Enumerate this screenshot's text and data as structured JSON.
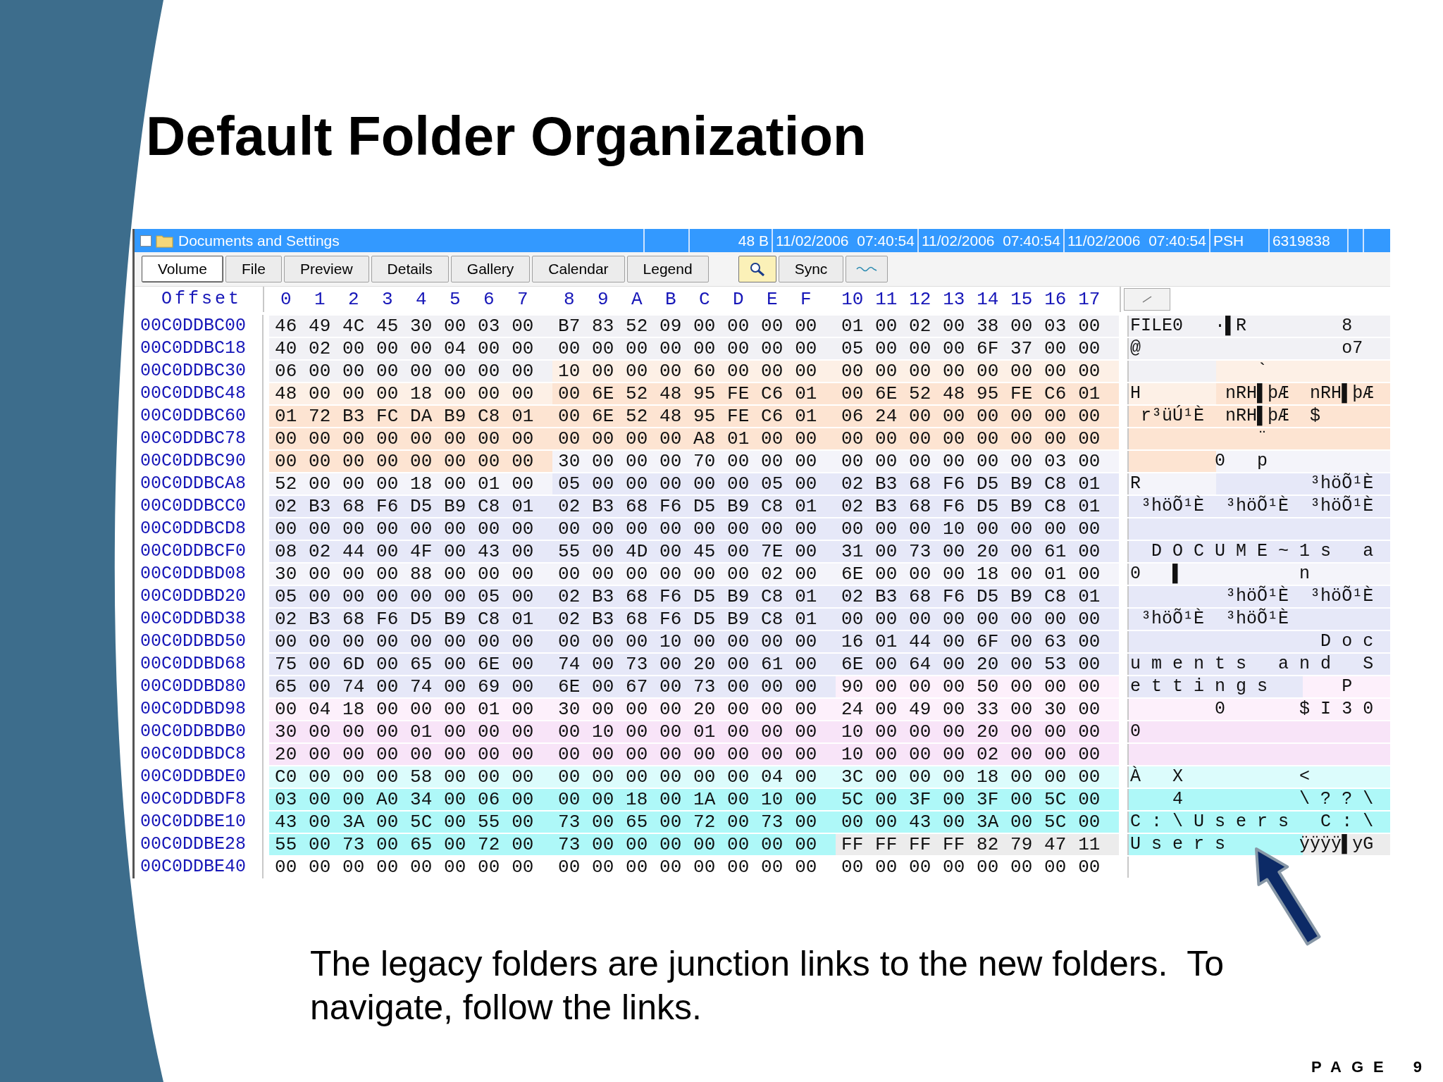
{
  "title": "Default Folder Organization",
  "file_entry": {
    "checked": false,
    "name": "Documents and Settings",
    "cells": [
      "48 B",
      "11/02/2006  07:40:54",
      "11/02/2006  07:40:54",
      "11/02/2006  07:40:54",
      "PSH",
      "6319838"
    ]
  },
  "tabs": [
    {
      "label": "Volume",
      "selected": true
    },
    {
      "label": "File",
      "selected": false
    },
    {
      "label": "Preview",
      "selected": false
    },
    {
      "label": "Details",
      "selected": false
    },
    {
      "label": "Gallery",
      "selected": false
    },
    {
      "label": "Calendar",
      "selected": false
    },
    {
      "label": "Legend",
      "selected": false
    }
  ],
  "sync_button": "Sync",
  "offset_header": "Offset",
  "column_labels": [
    "0",
    "1",
    "2",
    "3",
    "4",
    "5",
    "6",
    "7",
    "8",
    "9",
    "A",
    "B",
    "C",
    "D",
    "E",
    "F",
    "10",
    "11",
    "12",
    "13",
    "14",
    "15",
    "16",
    "17"
  ],
  "rows": [
    {
      "offset": "00C0DDBC00",
      "groups": [
        {
          "bytes": "46 49 4C 45 30 00 03 00",
          "color": "#f1f1f5"
        },
        {
          "bytes": "B7 83 52 09 00 00 00 00",
          "color": "#f1f1f5"
        },
        {
          "bytes": "01 00 02 00 38 00 03 00",
          "color": "#f1f1f5"
        }
      ],
      "ascii": "FILE0   ·▌R         8"
    },
    {
      "offset": "00C0DDBC18",
      "groups": [
        {
          "bytes": "40 02 00 00 00 04 00 00",
          "color": "#f1f1f5"
        },
        {
          "bytes": "00 00 00 00 00 00 00 00",
          "color": "#f1f1f5"
        },
        {
          "bytes": "05 00 00 00 6F 37 00 00",
          "color": "#f1f1f5"
        }
      ],
      "ascii": "@                   o7"
    },
    {
      "offset": "00C0DDBC30",
      "groups": [
        {
          "bytes": "06 00 00 00 00 00 00 00",
          "color": "#f1f1f5"
        },
        {
          "bytes": "10 00 00 00 60 00 00 00",
          "color": "#fdf0e6"
        },
        {
          "bytes": "00 00 00 00 00 00 00 00",
          "color": "#fdf0e6"
        }
      ],
      "ascii": "            `"
    },
    {
      "offset": "00C0DDBC48",
      "groups": [
        {
          "bytes": "48 00 00 00 18 00 00 00",
          "color": "#fdf0e6"
        },
        {
          "bytes": "00 6E 52 48 95 FE C6 01",
          "color": "#fde4d2"
        },
        {
          "bytes": "00 6E 52 48 95 FE C6 01",
          "color": "#fde4d2"
        }
      ],
      "ascii": "H        nRH▌þÆ  nRH▌þÆ"
    },
    {
      "offset": "00C0DDBC60",
      "groups": [
        {
          "bytes": "01 72 B3 FC DA B9 C8 01",
          "color": "#fde4d2"
        },
        {
          "bytes": "00 6E 52 48 95 FE C6 01",
          "color": "#fde4d2"
        },
        {
          "bytes": "06 24 00 00 00 00 00 00",
          "color": "#fde4d2"
        }
      ],
      "ascii": " r³üÚ¹È  nRH▌þÆ  $"
    },
    {
      "offset": "00C0DDBC78",
      "groups": [
        {
          "bytes": "00 00 00 00 00 00 00 00",
          "color": "#fde4d2"
        },
        {
          "bytes": "00 00 00 00 A8 01 00 00",
          "color": "#fde4d2"
        },
        {
          "bytes": "00 00 00 00 00 00 00 00",
          "color": "#fde4d2"
        }
      ],
      "ascii": "            ¨"
    },
    {
      "offset": "00C0DDBC90",
      "groups": [
        {
          "bytes": "00 00 00 00 00 00 00 00",
          "color": "#fde4d2"
        },
        {
          "bytes": "30 00 00 00 70 00 00 00",
          "color": "#f4f4fa"
        },
        {
          "bytes": "00 00 00 00 00 00 03 00",
          "color": "#f4f4fa"
        }
      ],
      "ascii": "        0   p"
    },
    {
      "offset": "00C0DDBCA8",
      "groups": [
        {
          "bytes": "52 00 00 00 18 00 01 00",
          "color": "#f4f4fa"
        },
        {
          "bytes": "05 00 00 00 00 00 05 00",
          "color": "#e6e8f8"
        },
        {
          "bytes": "02 B3 68 F6 D5 B9 C8 01",
          "color": "#e6e8f8"
        }
      ],
      "ascii": "R                ³höÕ¹È"
    },
    {
      "offset": "00C0DDBCC0",
      "groups": [
        {
          "bytes": "02 B3 68 F6 D5 B9 C8 01",
          "color": "#e6e8f8"
        },
        {
          "bytes": "02 B3 68 F6 D5 B9 C8 01",
          "color": "#e6e8f8"
        },
        {
          "bytes": "02 B3 68 F6 D5 B9 C8 01",
          "color": "#e6e8f8"
        }
      ],
      "ascii": " ³höÕ¹È  ³höÕ¹È  ³höÕ¹È"
    },
    {
      "offset": "00C0DDBCD8",
      "groups": [
        {
          "bytes": "00 00 00 00 00 00 00 00",
          "color": "#e6e8f8"
        },
        {
          "bytes": "00 00 00 00 00 00 00 00",
          "color": "#e6e8f8"
        },
        {
          "bytes": "00 00 00 10 00 00 00 00",
          "color": "#e6e8f8"
        }
      ]
    },
    {
      "offset": "00C0DDBCF0",
      "groups": [
        {
          "bytes": "08 02 44 00 4F 00 43 00",
          "color": "#e6e8f8"
        },
        {
          "bytes": "55 00 4D 00 45 00 7E 00",
          "color": "#e6e8f8"
        },
        {
          "bytes": "31 00 73 00 20 00 61 00",
          "color": "#e6e8f8"
        }
      ],
      "ascii": "  D O C U M E ~ 1 s   a"
    },
    {
      "offset": "00C0DDBD08",
      "groups": [
        {
          "bytes": "30 00 00 00 88 00 00 00",
          "color": "#f4f4fa"
        },
        {
          "bytes": "00 00 00 00 00 00 02 00",
          "color": "#f4f4fa"
        },
        {
          "bytes": "6E 00 00 00 18 00 01 00",
          "color": "#f4f4fa"
        }
      ],
      "ascii": "0   ▌           n"
    },
    {
      "offset": "00C0DDBD20",
      "groups": [
        {
          "bytes": "05 00 00 00 00 00 05 00",
          "color": "#e6e8f8"
        },
        {
          "bytes": "02 B3 68 F6 D5 B9 C8 01",
          "color": "#e6e8f8"
        },
        {
          "bytes": "02 B3 68 F6 D5 B9 C8 01",
          "color": "#e6e8f8"
        }
      ],
      "ascii": "         ³höÕ¹È  ³höÕ¹È"
    },
    {
      "offset": "00C0DDBD38",
      "groups": [
        {
          "bytes": "02 B3 68 F6 D5 B9 C8 01",
          "color": "#e6e8f8"
        },
        {
          "bytes": "02 B3 68 F6 D5 B9 C8 01",
          "color": "#e6e8f8"
        },
        {
          "bytes": "00 00 00 00 00 00 00 00",
          "color": "#e6e8f8"
        }
      ],
      "ascii": " ³höÕ¹È  ³höÕ¹È"
    },
    {
      "offset": "00C0DDBD50",
      "groups": [
        {
          "bytes": "00 00 00 00 00 00 00 00",
          "color": "#e6e8f8"
        },
        {
          "bytes": "00 00 00 10 00 00 00 00",
          "color": "#e6e8f8"
        },
        {
          "bytes": "16 01 44 00 6F 00 63 00",
          "color": "#e6e8f8"
        }
      ],
      "ascii": "                  D o c"
    },
    {
      "offset": "00C0DDBD68",
      "groups": [
        {
          "bytes": "75 00 6D 00 65 00 6E 00",
          "color": "#e6e8f8"
        },
        {
          "bytes": "74 00 73 00 20 00 61 00",
          "color": "#e6e8f8"
        },
        {
          "bytes": "6E 00 64 00 20 00 53 00",
          "color": "#e6e8f8"
        }
      ],
      "ascii": "u m e n t s   a n d   S"
    },
    {
      "offset": "00C0DDBD80",
      "groups": [
        {
          "bytes": "65 00 74 00 74 00 69 00",
          "color": "#e6e8f8"
        },
        {
          "bytes": "6E 00 67 00 73 00 00 00",
          "color": "#e6e8f8"
        },
        {
          "bytes": "90 00 00 00 50 00 00 00",
          "color": "#fdf0fb"
        }
      ],
      "ascii": "e t t i n g s       P"
    },
    {
      "offset": "00C0DDBD98",
      "groups": [
        {
          "bytes": "00 04 18 00 00 00 01 00",
          "color": "#fdf0fb"
        },
        {
          "bytes": "30 00 00 00 20 00 00 00",
          "color": "#fdf0fb"
        },
        {
          "bytes": "24 00 49 00 33 00 30 00",
          "color": "#fdf0fb"
        }
      ],
      "ascii": "        0       $ I 3 0"
    },
    {
      "offset": "00C0DDBDB0",
      "groups": [
        {
          "bytes": "30 00 00 00 01 00 00 00",
          "color": "#f8e4f8"
        },
        {
          "bytes": "00 10 00 00 01 00 00 00",
          "color": "#f8e4f8"
        },
        {
          "bytes": "10 00 00 00 20 00 00 00",
          "color": "#f8e4f8"
        }
      ],
      "ascii": "0"
    },
    {
      "offset": "00C0DDBDC8",
      "groups": [
        {
          "bytes": "20 00 00 00 00 00 00 00",
          "color": "#f8e4f8"
        },
        {
          "bytes": "00 00 00 00 00 00 00 00",
          "color": "#f8e4f8"
        },
        {
          "bytes": "10 00 00 00 02 00 00 00",
          "color": "#f8e4f8"
        }
      ]
    },
    {
      "offset": "00C0DDBDE0",
      "groups": [
        {
          "bytes": "C0 00 00 00 58 00 00 00",
          "color": "#dcfcfc"
        },
        {
          "bytes": "00 00 00 00 00 00 04 00",
          "color": "#dcfcfc"
        },
        {
          "bytes": "3C 00 00 00 18 00 00 00",
          "color": "#dcfcfc"
        }
      ],
      "ascii": "À   X           <"
    },
    {
      "offset": "00C0DDBDF8",
      "groups": [
        {
          "bytes": "03 00 00 A0 34 00 06 00",
          "color": "#aef8f8"
        },
        {
          "bytes": "00 00 18 00 1A 00 10 00",
          "color": "#aef8f8"
        },
        {
          "bytes": "5C 00 3F 00 3F 00 5C 00",
          "color": "#aef8f8"
        }
      ],
      "ascii": "    4           \\ ? ? \\"
    },
    {
      "offset": "00C0DDBE10",
      "groups": [
        {
          "bytes": "43 00 3A 00 5C 00 55 00",
          "color": "#aef8f8"
        },
        {
          "bytes": "73 00 65 00 72 00 73 00",
          "color": "#aef8f8"
        },
        {
          "bytes": "00 00 43 00 3A 00 5C 00",
          "color": "#aef8f8"
        }
      ],
      "ascii": "C : \\ U s e r s   C : \\"
    },
    {
      "offset": "00C0DDBE28",
      "groups": [
        {
          "bytes": "55 00 73 00 65 00 72 00",
          "color": "#aef8f8"
        },
        {
          "bytes": "73 00 00 00 00 00 00 00",
          "color": "#aef8f8"
        },
        {
          "bytes": "FF FF FF FF 82 79 47 11",
          "color": "#ececec"
        }
      ],
      "ascii": "U s e r s       ÿÿÿÿ▌yG"
    },
    {
      "offset": "00C0DDBE40",
      "groups": [
        {
          "bytes": "00 00 00 00 00 00 00 00",
          "color": "#ffffff"
        },
        {
          "bytes": "00 00 00 00 00 00 00 00",
          "color": "#ffffff"
        },
        {
          "bytes": "00 00 00 00 00 00 00 00",
          "color": "#ffffff"
        }
      ]
    }
  ],
  "caption": "The legacy folders are junction links to the new folders.  To navigate, follow the links.",
  "page_label": "PAGE",
  "page_number": "9"
}
